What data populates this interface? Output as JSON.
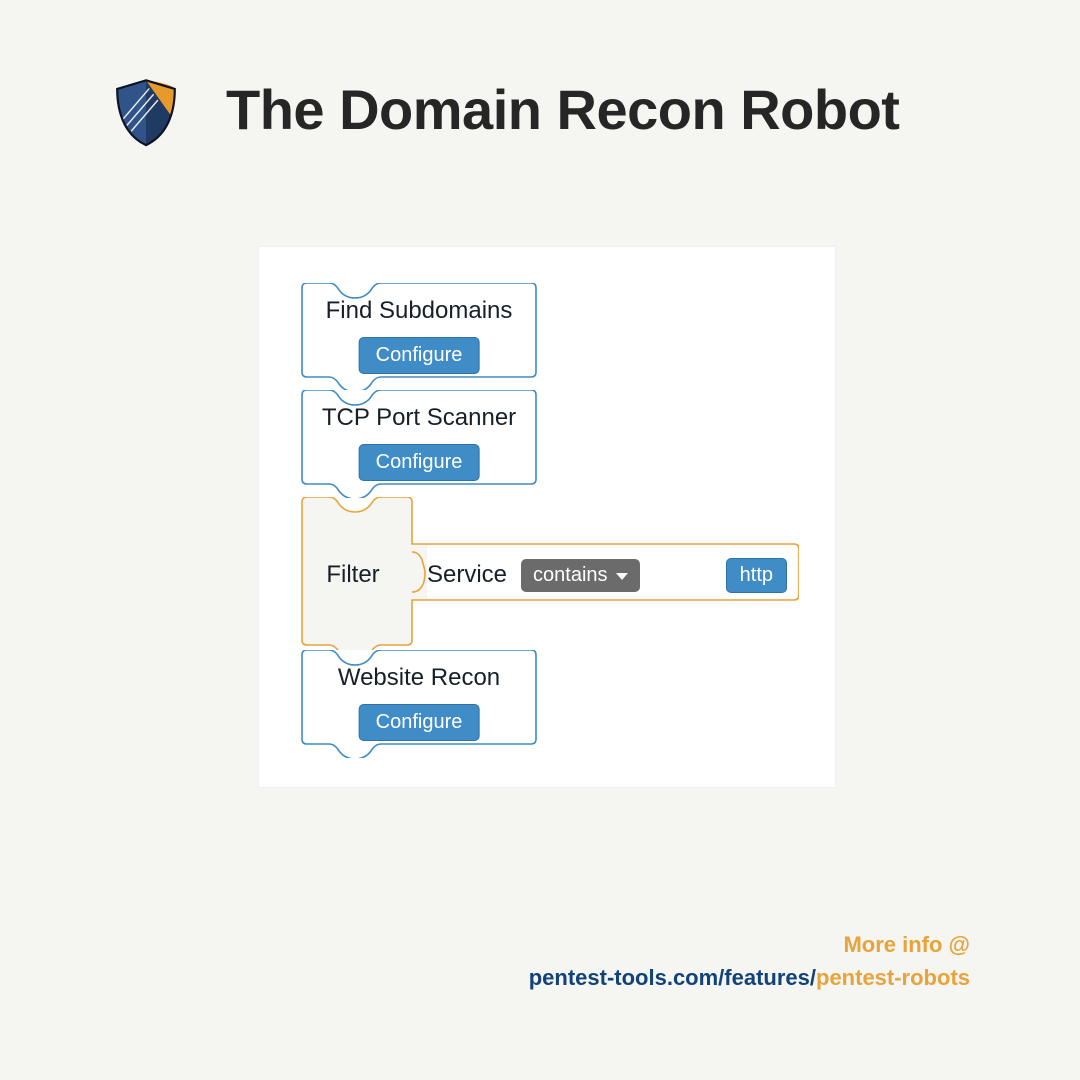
{
  "header": {
    "title": "The Domain Recon Robot"
  },
  "blocks": {
    "find_subdomains": {
      "label": "Find Subdomains",
      "configure": "Configure"
    },
    "tcp_port_scanner": {
      "label": "TCP Port Scanner",
      "configure": "Configure"
    },
    "filter": {
      "label": "Filter",
      "field": "Service",
      "operator": "contains",
      "value": "http"
    },
    "website_recon": {
      "label": "Website Recon",
      "configure": "Configure"
    }
  },
  "footer": {
    "more_info": "More info @",
    "link_base": "pentest-tools.com/features/",
    "link_highlight": "pentest-robots"
  },
  "colors": {
    "block_blue": "#3f8cc7",
    "block_orange": "#e8a33b",
    "chip_grey": "#6b6b6b",
    "navy": "#12427a"
  }
}
